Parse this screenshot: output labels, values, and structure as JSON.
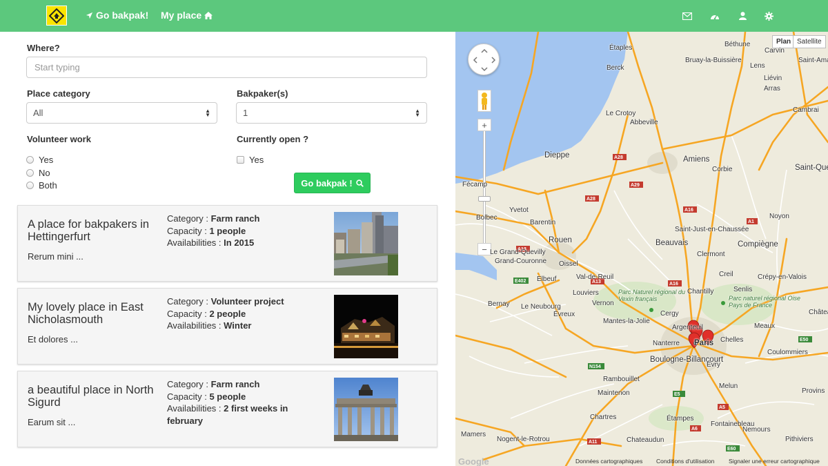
{
  "navbar": {
    "brand_link": "Go bakpak!",
    "my_place_link": "My place",
    "icons": [
      "envelope-icon",
      "dashboard-icon",
      "user-icon",
      "gear-icon"
    ]
  },
  "search": {
    "where_label": "Where?",
    "where_placeholder": "Start typing",
    "category_label": "Place category",
    "category_value": "All",
    "bakpakers_label": "Bakpaker(s)",
    "bakpakers_value": "1",
    "volunteer_label": "Volunteer work",
    "volunteer_options": [
      "Yes",
      "No",
      "Both"
    ],
    "open_label": "Currently open ?",
    "open_option": "Yes",
    "go_button": "Go bakpak !"
  },
  "labels": {
    "category": "Category :",
    "capacity": "Capacity :",
    "availabilities": "Availabilities :"
  },
  "places": [
    {
      "title": "A place for bakpakers in Hettingerfurt",
      "desc": "Rerum mini ...",
      "category": "Farm ranch",
      "capacity": "1 people",
      "availabilities": "In 2015",
      "image": "city-skyline-photo"
    },
    {
      "title": "My lovely place in East Nicholasmouth",
      "desc": "Et dolores ...",
      "category": "Volunteer project",
      "capacity": "2 people",
      "availabilities": "Winter",
      "image": "night-city-photo"
    },
    {
      "title": "a beautiful place in North Sigurd",
      "desc": "Earum sit ...",
      "category": "Farm ranch",
      "capacity": "5 people",
      "availabilities": "2 first weeks in february",
      "image": "brandenburg-gate-photo"
    }
  ],
  "map": {
    "type_plan": "Plan",
    "type_satellite": "Satellite",
    "cities": {
      "etaples": "Étaples",
      "bethune": "Béthune",
      "carvin": "Carvin",
      "bruay": "Bruay-la-Buissière",
      "lens": "Lens",
      "lievin": "Liévin",
      "saint_amand": "Saint-Amand",
      "berck": "Berck",
      "arras": "Arras",
      "le_crotoy": "Le Crotoy",
      "abbeville": "Abbeville",
      "cambrai": "Cambrai",
      "dieppe": "Dieppe",
      "amiens": "Amiens",
      "corbie": "Corbie",
      "saint_quentin": "Saint-Quentin",
      "fecamp": "Fécamp",
      "yvetot": "Yvetot",
      "bolbec": "Bolbec",
      "barentin": "Barentin",
      "noyon": "Noyon",
      "saint_just": "Saint-Just-en-Chaussée",
      "rouen": "Rouen",
      "beauvais": "Beauvais",
      "compiegne": "Compiègne",
      "le_grand_quevilly": "Le Grand-Quevilly",
      "grand_couronne": "Grand-Couronne",
      "oissel": "Oissel",
      "clermont": "Clermont",
      "elbeuf": "Elbeuf",
      "val_de_reuil": "Val-de-Reuil",
      "creil": "Creil",
      "crepy": "Crépy-en-Valois",
      "louviers": "Louviers",
      "chantilly": "Chantilly",
      "senlis": "Senlis",
      "bernay": "Bernay",
      "le_neubourg": "Le Neubourg",
      "vernon": "Vernon",
      "evreux": "Évreux",
      "mantes": "Mantes-la-Jolie",
      "cergy": "Cergy",
      "meaux": "Meaux",
      "chateau": "Château",
      "argenteuil": "Argenteuil",
      "nanterre": "Nanterre",
      "paris": "Paris",
      "chelles": "Chelles",
      "boulogne": "Boulogne-Billancourt",
      "coulommiers": "Coulommiers",
      "rambouillet": "Rambouillet",
      "evry": "Évry",
      "maintenon": "Maintenon",
      "melun": "Melun",
      "provins": "Provins",
      "chartres": "Chartres",
      "etampes": "Étampes",
      "fontainebleau": "Fontainebleau",
      "nemours": "Nemours",
      "mamers": "Mamers",
      "nogent": "Nogent-le-Rotrou",
      "chateaudun": "Chateaudun",
      "pithiviers": "Pithiviers"
    },
    "parks": {
      "vexin": "Parc Naturel régional du Vexin français",
      "oise": "Parc naturel régional Oise Pays de France"
    },
    "roads": [
      "A28",
      "A29",
      "A28",
      "A16",
      "A1",
      "A13",
      "A16",
      "A13",
      "E402",
      "N154",
      "A11",
      "E5",
      "E50",
      "A5",
      "A10",
      "A6",
      "E60",
      "A19"
    ],
    "footer": {
      "google": "Google",
      "map_data": "Données cartographiques",
      "terms": "Conditions d'utilisation",
      "report": "Signaler une erreur cartographique"
    },
    "colors": {
      "land": "#eeebdd",
      "water": "#a3c5f0",
      "highway": "#f6a623",
      "road": "#ffffff",
      "urban": "#e0dccc",
      "marker": "#e0302a"
    }
  }
}
